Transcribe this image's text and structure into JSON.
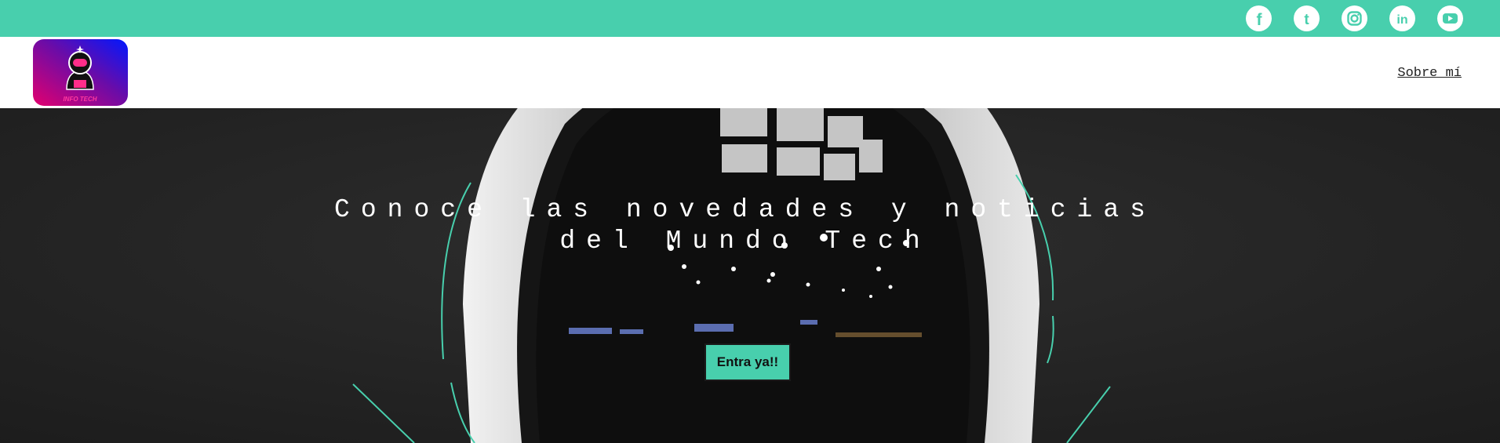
{
  "colors": {
    "accent": "#48cfad",
    "hero_bg": "#262626",
    "nav_bg": "#ffffff"
  },
  "social": [
    {
      "name": "facebook-icon",
      "glyph": "f"
    },
    {
      "name": "tumblr-icon",
      "glyph": "t"
    },
    {
      "name": "instagram-icon",
      "glyph": ""
    },
    {
      "name": "linkedin-icon",
      "glyph": "in"
    },
    {
      "name": "youtube-icon",
      "glyph": ""
    }
  ],
  "logo": {
    "text": "INFO TECH"
  },
  "nav": {
    "about_label": "Sobre mí"
  },
  "hero": {
    "title": "Conoce las novedades y noticias del Mundo Tech",
    "button_label": "Entra ya!!"
  }
}
